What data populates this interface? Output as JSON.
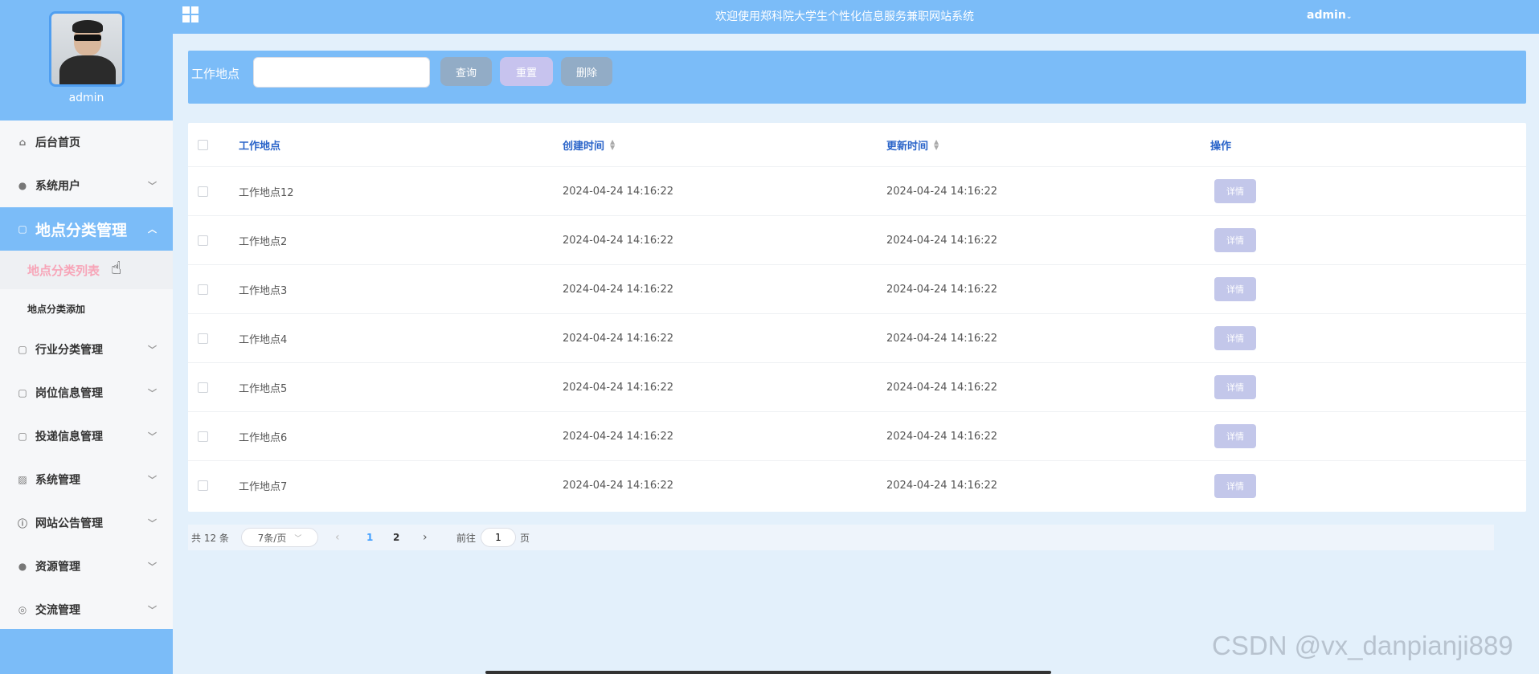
{
  "sidebar": {
    "username": "admin",
    "menu": [
      {
        "label": "后台首页",
        "icon": "home-icon"
      },
      {
        "label": "系统用户",
        "icon": "user-icon"
      },
      {
        "label": "地点分类管理",
        "icon": "doc-icon"
      },
      {
        "label": "行业分类管理",
        "icon": "doc-icon"
      },
      {
        "label": "岗位信息管理",
        "icon": "doc-icon"
      },
      {
        "label": "投递信息管理",
        "icon": "doc-icon"
      },
      {
        "label": "系统管理",
        "icon": "image-icon"
      },
      {
        "label": "网站公告管理",
        "icon": "info-icon"
      },
      {
        "label": "资源管理",
        "icon": "location-icon"
      },
      {
        "label": "交流管理",
        "icon": "chat-icon"
      }
    ],
    "submenu": {
      "list_label": "地点分类列表",
      "add_label": "地点分类添加"
    }
  },
  "header": {
    "title": "欢迎使用郑科院大学生个性化信息服务兼职网站系统",
    "user": "admin"
  },
  "search": {
    "label": "工作地点",
    "value": "",
    "query_label": "查询",
    "reset_label": "重置",
    "delete_label": "删除"
  },
  "table": {
    "columns": {
      "name": "工作地点",
      "created": "创建时间",
      "updated": "更新时间",
      "op": "操作"
    },
    "detail_label": "详情",
    "rows": [
      {
        "name": "工作地点12",
        "created": "2024-04-24 14:16:22",
        "updated": "2024-04-24 14:16:22"
      },
      {
        "name": "工作地点2",
        "created": "2024-04-24 14:16:22",
        "updated": "2024-04-24 14:16:22"
      },
      {
        "name": "工作地点3",
        "created": "2024-04-24 14:16:22",
        "updated": "2024-04-24 14:16:22"
      },
      {
        "name": "工作地点4",
        "created": "2024-04-24 14:16:22",
        "updated": "2024-04-24 14:16:22"
      },
      {
        "name": "工作地点5",
        "created": "2024-04-24 14:16:22",
        "updated": "2024-04-24 14:16:22"
      },
      {
        "name": "工作地点6",
        "created": "2024-04-24 14:16:22",
        "updated": "2024-04-24 14:16:22"
      },
      {
        "name": "工作地点7",
        "created": "2024-04-24 14:16:22",
        "updated": "2024-04-24 14:16:22"
      }
    ]
  },
  "pagination": {
    "total": "共 12 条",
    "page_size": "7条/页",
    "page1": "1",
    "page2": "2",
    "goto_label": "前往",
    "goto_value": "1",
    "unit": "页"
  },
  "watermark": "CSDN @vx_danpianji889",
  "colors": {
    "primary": "#7bbcf8",
    "header_text": "#2a64c9",
    "reset_button": "#c7c3ee",
    "selected_submenu": "#f7a5b8"
  }
}
